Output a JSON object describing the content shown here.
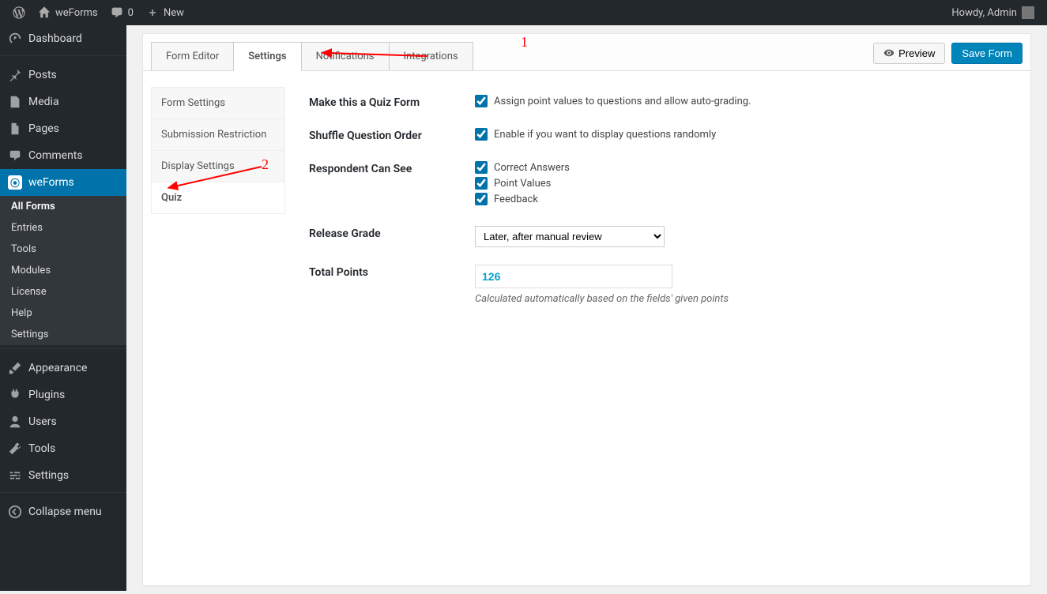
{
  "adminbar": {
    "site_name": "weForms",
    "comments_count": "0",
    "new_label": "New",
    "howdy": "Howdy, Admin"
  },
  "sidebar": {
    "dashboard": "Dashboard",
    "posts": "Posts",
    "media": "Media",
    "pages": "Pages",
    "comments": "Comments",
    "weforms": "weForms",
    "weforms_sub": [
      "All Forms",
      "Entries",
      "Tools",
      "Modules",
      "License",
      "Help",
      "Settings"
    ],
    "appearance": "Appearance",
    "plugins": "Plugins",
    "users": "Users",
    "tools": "Tools",
    "settings": "Settings",
    "collapse": "Collapse menu"
  },
  "tabs": {
    "form_editor": "Form Editor",
    "settings": "Settings",
    "notifications": "Notifications",
    "integrations": "Integrations"
  },
  "actions": {
    "preview": "Preview",
    "save": "Save Form"
  },
  "settings_nav": {
    "form_settings": "Form Settings",
    "submission_restriction": "Submission Restriction",
    "display_settings": "Display Settings",
    "quiz": "Quiz"
  },
  "form": {
    "quiz_label": "Make this a Quiz Form",
    "quiz_check": "Assign point values to questions and allow auto-grading.",
    "shuffle_label": "Shuffle Question Order",
    "shuffle_check": "Enable if you want to display questions randomly",
    "respondent_label": "Respondent Can See",
    "respondent_opts": [
      "Correct Answers",
      "Point Values",
      "Feedback"
    ],
    "release_label": "Release Grade",
    "release_option": "Later, after manual review",
    "total_label": "Total Points",
    "total_value": "126",
    "total_hint": "Calculated automatically based on the fields' given points"
  },
  "annotations": {
    "n1": "1",
    "n2": "2"
  }
}
